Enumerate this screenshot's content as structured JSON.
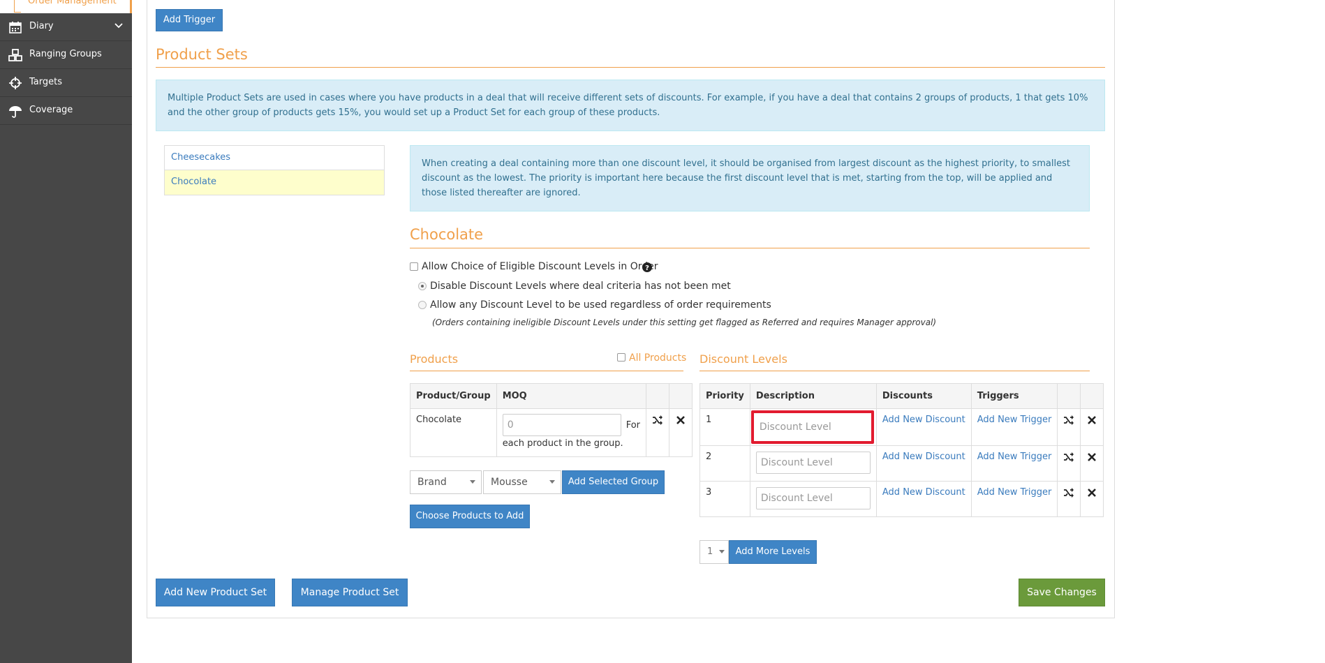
{
  "sidebar": {
    "active_item": "Order Management",
    "items": [
      {
        "label": "Diary",
        "icon": "calendar-icon",
        "has_children": true
      },
      {
        "label": "Ranging Groups",
        "icon": "cubes-icon",
        "has_children": false
      },
      {
        "label": "Targets",
        "icon": "crosshairs-icon",
        "has_children": false
      },
      {
        "label": "Coverage",
        "icon": "umbrella-icon",
        "has_children": false
      }
    ]
  },
  "add_trigger_label": "Add Trigger",
  "product_sets": {
    "title": "Product Sets",
    "info": "Multiple Product Sets are used in cases where you have products in a deal that will receive different sets of discounts. For example, if you have a deal that contains 2 groups of products, 1 that gets 10% and the other group of products gets 15%, you would set up a Product Set for each group of these products.",
    "sets": [
      "Cheesecakes",
      "Chocolate"
    ],
    "selected": "Chocolate"
  },
  "detail": {
    "info": "When creating a deal containing more than one discount level, it should be organised from largest discount as the highest priority, to smallest discount as the lowest. The priority is important here because the first discount level that is met, starting from the top, will be applied and those listed thereafter are ignored.",
    "title": "Chocolate",
    "allow_choice_label": "Allow Choice of Eligible Discount Levels in Order",
    "option_disable_label": "Disable Discount Levels where deal criteria has not been met",
    "option_allow_label": "Allow any Discount Level to be used regardless of order requirements",
    "option_note": "(Orders containing ineligible Discount Levels under this setting get flagged as Referred and requires Manager approval)"
  },
  "products": {
    "title": "Products",
    "all_products_label": "All Products",
    "columns": [
      "Product/Group",
      "MOQ"
    ],
    "rows": [
      {
        "name": "Chocolate",
        "moq": "0",
        "moq_suffix": "For",
        "moq_note": "each product in the group."
      }
    ],
    "brand_select": "Brand",
    "group_select": "Mousse",
    "add_group_label": "Add Selected Group",
    "choose_products_label": "Choose Products to Add"
  },
  "discount_levels": {
    "title": "Discount Levels",
    "columns": [
      "Priority",
      "Description",
      "Discounts",
      "Triggers"
    ],
    "description_placeholder": "Discount Level",
    "add_discount_label": "Add New Discount",
    "add_trigger_label": "Add New Trigger",
    "rows": [
      {
        "priority": "1"
      },
      {
        "priority": "2"
      },
      {
        "priority": "3"
      }
    ],
    "more_count": "1",
    "add_more_label": "Add More Levels"
  },
  "footer": {
    "add_set_label": "Add New Product Set",
    "manage_set_label": "Manage Product Set",
    "save_label": "Save Changes"
  },
  "colors": {
    "accent": "#f0a04b",
    "primary": "#3f85c6",
    "success": "#6b9a3b",
    "sidebar": "#474747",
    "highlight": "#e21b2f"
  }
}
